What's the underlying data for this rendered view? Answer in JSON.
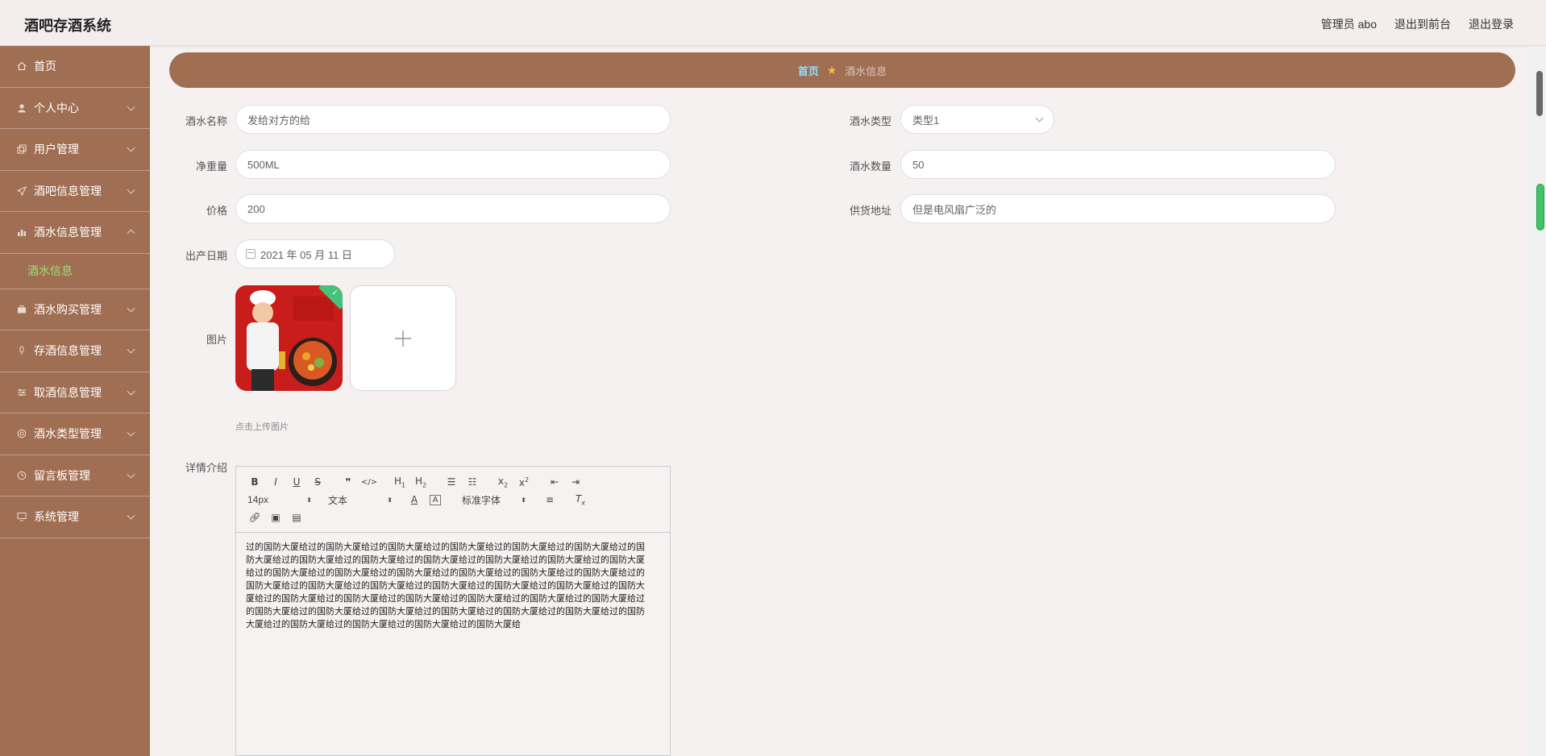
{
  "header": {
    "title": "酒吧存酒系统",
    "user": "管理员 abo",
    "to_front": "退出到前台",
    "logout": "退出登录"
  },
  "sidebar": {
    "items": [
      {
        "label": "首页",
        "icon": "home-icon"
      },
      {
        "label": "个人中心",
        "icon": "user-icon"
      },
      {
        "label": "用户管理",
        "icon": "copy-icon"
      },
      {
        "label": "酒吧信息管理",
        "icon": "send-icon"
      },
      {
        "label": "酒水信息管理",
        "icon": "chart-icon"
      },
      {
        "label": "酒水购买管理",
        "icon": "briefcase-icon"
      },
      {
        "label": "存酒信息管理",
        "icon": "mic-icon"
      },
      {
        "label": "取酒信息管理",
        "icon": "sliders-icon"
      },
      {
        "label": "酒水类型管理",
        "icon": "globe-icon"
      },
      {
        "label": "留言板管理",
        "icon": "clock-icon"
      },
      {
        "label": "系统管理",
        "icon": "monitor-icon"
      }
    ],
    "active_sub": "酒水信息"
  },
  "breadcrumb": {
    "home": "首页",
    "current": "酒水信息"
  },
  "form": {
    "name_label": "酒水名称",
    "name_value": "发给对方的给",
    "type_label": "酒水类型",
    "type_value": "类型1",
    "volume_label": "净重量",
    "volume_value": "500ML",
    "count_label": "酒水数量",
    "count_value": "50",
    "price_label": "价格",
    "price_value": "200",
    "supply_label": "供货地址",
    "supply_value": "但是电风扇广泛的",
    "date_label": "出产日期",
    "date_value": "2021 年 05 月 11 日",
    "image_label": "图片",
    "upload_tip": "点击上传图片",
    "detail_label": "详情介绍"
  },
  "editor": {
    "font_size": "14px",
    "paragraph": "文本",
    "font_family": "标准字体",
    "content": "过的国防大厦给过的国防大厦给过的国防大厦给过的国防大厦给过的国防大厦给过的国防大厦给过的国防大厦给过的国防大厦给过的国防大厦给过的国防大厦给过的国防大厦给过的国防大厦给过的国防大厦给过的国防大厦给过的国防大厦给过的国防大厦给过的国防大厦给过的国防大厦给过的国防大厦给过的国防大厦给过的国防大厦给过的国防大厦给过的国防大厦给过的国防大厦给过的国防大厦给过的国防大厦给过的国防大厦给过的国防大厦给过的国防大厦给过的国防大厦给过的国防大厦给过的国防大厦给过的国防大厦给过的国防大厦给过的国防大厦给过的国防大厦给过的国防大厦给过的国防大厦给过的国防大厦给过的国防大厦给过的国防大厦给过的国防大厦给过的国防大厦给"
  },
  "colors": {
    "primary": "#a06e52",
    "active": "#9be27a",
    "crumb_home": "#8fe0ff"
  }
}
